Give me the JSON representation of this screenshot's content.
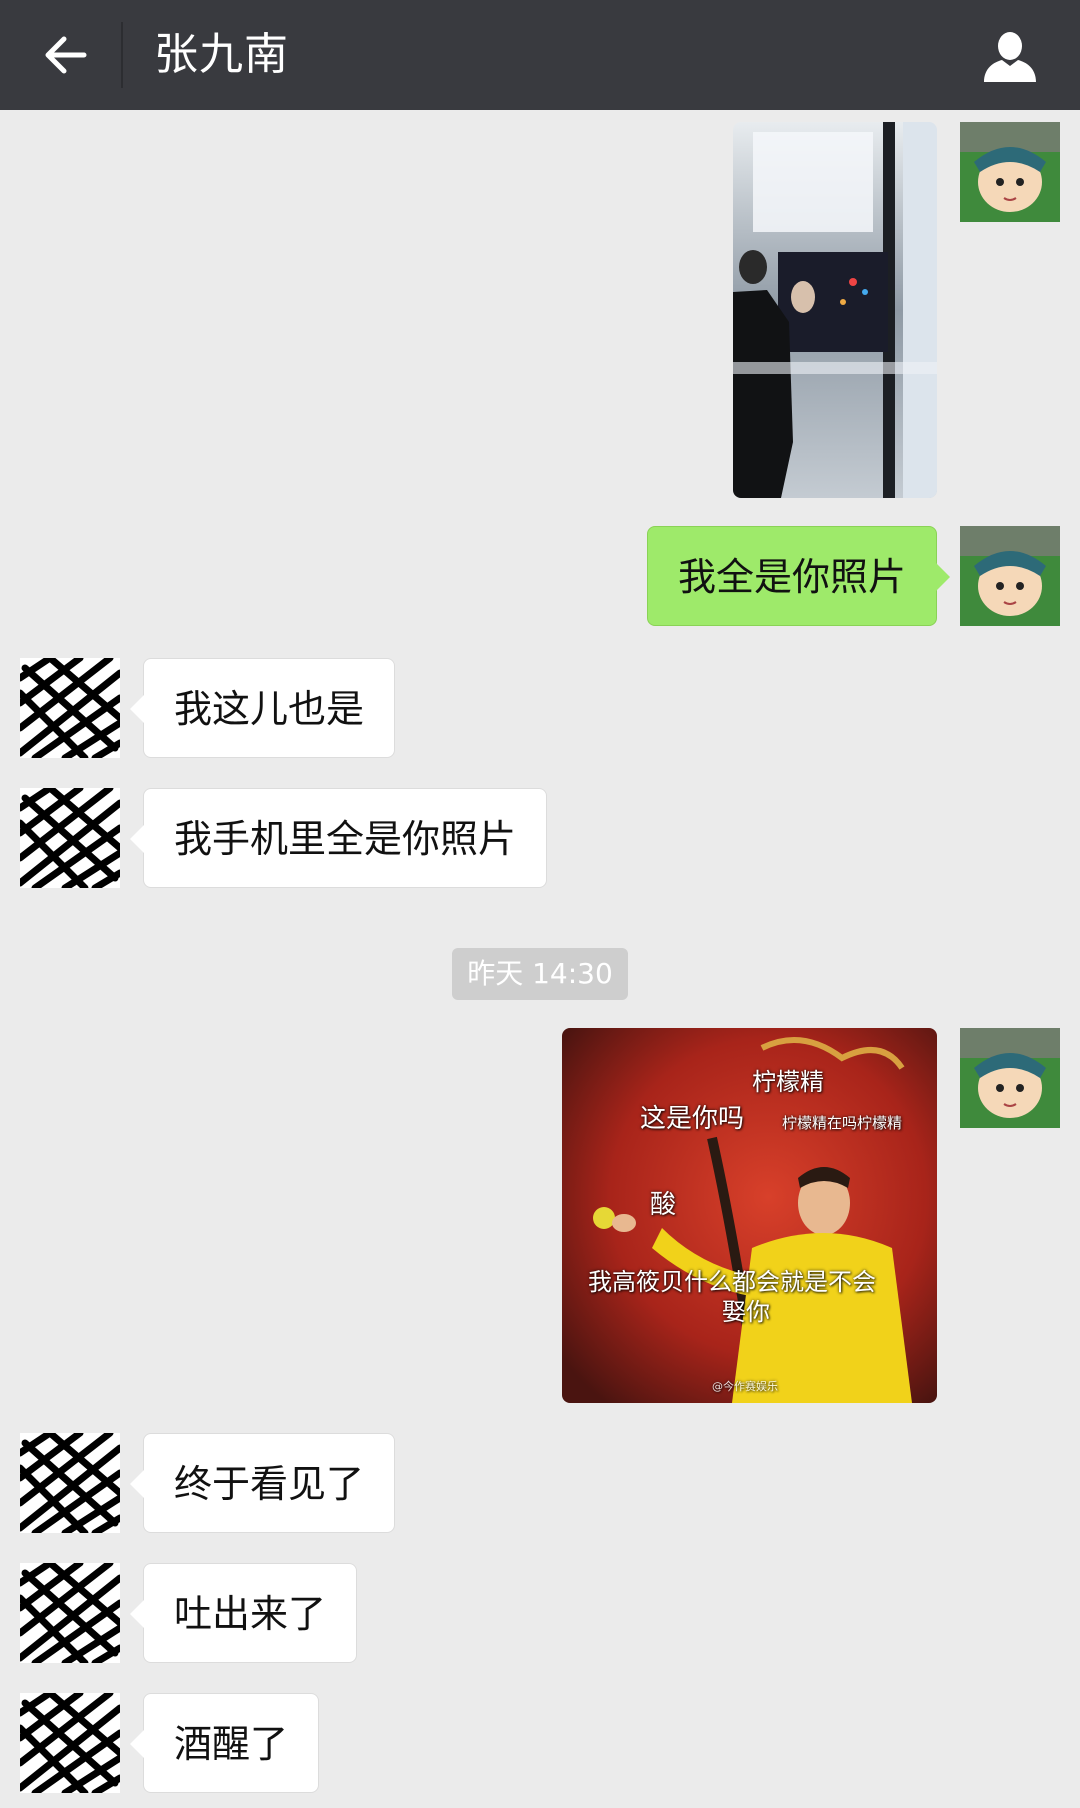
{
  "header": {
    "title": "张九南",
    "back_icon": "arrow-left-icon",
    "profile_icon": "person-icon"
  },
  "messages": {
    "m2": "我全是你照片",
    "m3": "我这儿也是",
    "m4": "我手机里全是你照片",
    "m6": "终于看见了",
    "m7": "吐出来了",
    "m8": "酒醒了"
  },
  "timestamp": "昨天 14:30",
  "meme": {
    "caption_top": "柠檬精",
    "caption_left": "这是你吗",
    "caption_right": "柠檬精在吗柠檬精",
    "caption_sour": "酸",
    "caption_bottom_1": "我高筱贝什么都会就是不会",
    "caption_bottom_2": "娶你",
    "watermark": "@今作赛娱乐"
  },
  "colors": {
    "header_bg": "#393a3f",
    "chat_bg": "#ebebeb",
    "self_bubble": "#9eea6a",
    "other_bubble": "#ffffff",
    "timestamp_bg": "#cecece"
  }
}
